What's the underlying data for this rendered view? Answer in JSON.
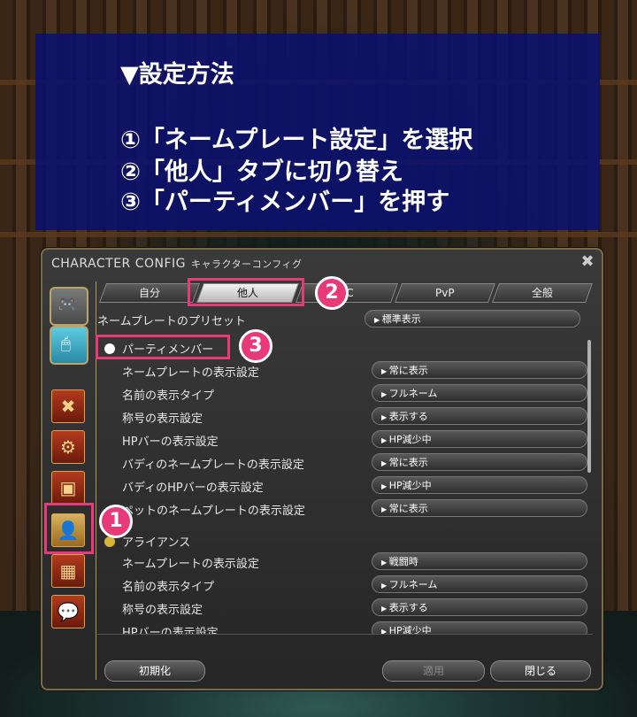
{
  "banner": {
    "heading": "▼設定方法",
    "steps": [
      "①「ネームプレート設定」を選択",
      "②「他人」タブに切り替え",
      "③「パーティメンバー」を押す"
    ]
  },
  "window": {
    "title": "CHARACTER CONFIG",
    "subtitle": "キャラクターコンフィグ",
    "close_icon": "close-icon",
    "tabs": [
      "自分",
      "他人",
      "PC",
      "PvP",
      "全般"
    ],
    "active_tab": "他人",
    "preset": {
      "label": "ネームプレートのプリセット",
      "value": "標準表示"
    },
    "party_section": "パーティメンバー",
    "party_rows": [
      {
        "label": "ネームプレートの表示設定",
        "value": "常に表示"
      },
      {
        "label": "名前の表示タイプ",
        "value": "フルネーム"
      },
      {
        "label": "称号の表示設定",
        "value": "表示する"
      },
      {
        "label": "HPバーの表示設定",
        "value": "HP減少中"
      },
      {
        "label": "バディのネームプレートの表示設定",
        "value": "常に表示"
      },
      {
        "label": "バディのHPバーの表示設定",
        "value": "HP減少中"
      },
      {
        "label": "ペットのネームプレートの表示設定",
        "value": "常に表示"
      }
    ],
    "alliance_section": "アライアンス",
    "alliance_rows": [
      {
        "label": "ネームプレートの表示設定",
        "value": "戦闘時"
      },
      {
        "label": "名前の表示タイプ",
        "value": "フルネーム"
      },
      {
        "label": "称号の表示設定",
        "value": "表示する"
      },
      {
        "label": "HPバーの表示設定",
        "value": "HP減少中"
      }
    ],
    "buttons": {
      "reset": "初期化",
      "apply": "適用",
      "close": "閉じる"
    }
  },
  "annotations": {
    "marker1": "1",
    "marker2": "2",
    "marker3": "3",
    "color": "#e83a78"
  }
}
